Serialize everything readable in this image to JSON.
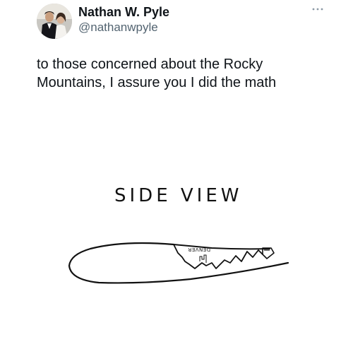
{
  "author": {
    "display_name": "Nathan W. Pyle",
    "handle": "@nathanwpyle",
    "avatar_icon": "profile-photo"
  },
  "header": {
    "more_icon": "more-horizontal-icon"
  },
  "tweet": {
    "text_line_1": "to those concerned about the Rocky",
    "text_line_2": "Mountains, I assure you I did the math"
  },
  "drawing": {
    "title": "SIDE VIEW",
    "city_label": "DENVER"
  }
}
